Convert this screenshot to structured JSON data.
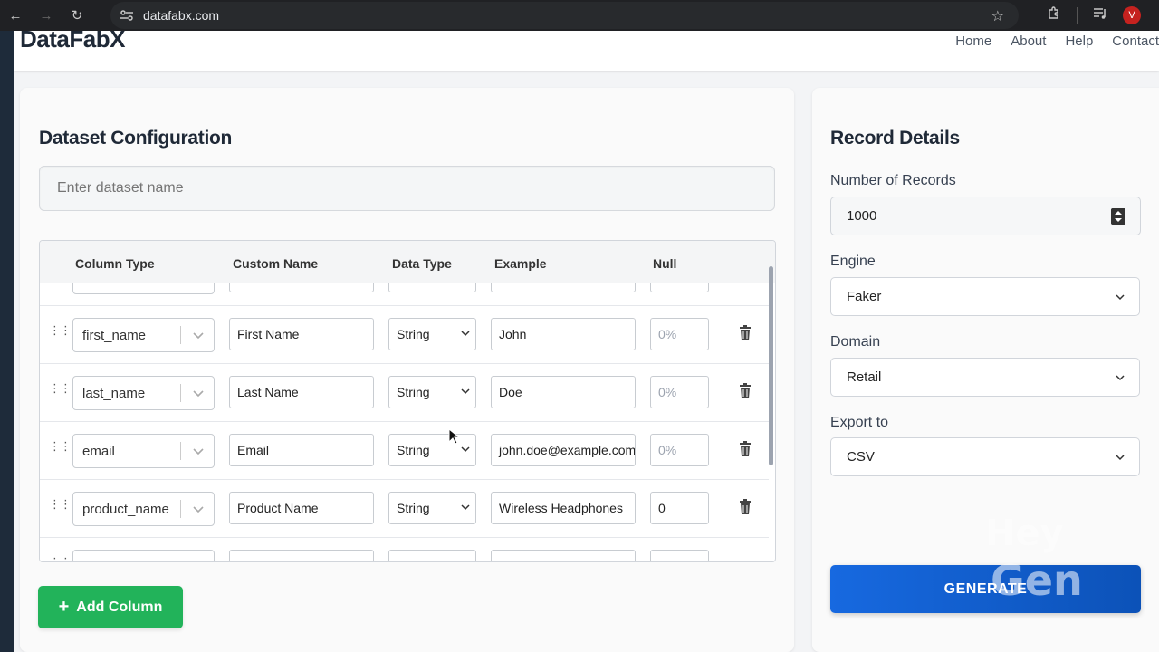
{
  "browser": {
    "url": "datafabx.com",
    "profile_initial": "V"
  },
  "site": {
    "brand": "DataFabX",
    "nav": [
      "Home",
      "About",
      "Help",
      "Contact"
    ]
  },
  "dataset": {
    "title": "Dataset Configuration",
    "name_placeholder": "Enter dataset name",
    "columns_header": [
      "Column Type",
      "Custom Name",
      "Data Type",
      "Example",
      "Null"
    ],
    "rows": [
      {
        "column_type": "first_name",
        "custom_name": "First Name",
        "data_type": "String",
        "example": "John",
        "null": "0%"
      },
      {
        "column_type": "last_name",
        "custom_name": "Last Name",
        "data_type": "String",
        "example": "Doe",
        "null": "0%"
      },
      {
        "column_type": "email",
        "custom_name": "Email",
        "data_type": "String",
        "example": "john.doe@example.com",
        "null": "0%"
      },
      {
        "column_type": "product_name",
        "custom_name": "Product Name",
        "data_type": "String",
        "example": "Wireless Headphones",
        "null": "0"
      }
    ],
    "add_column_label": "Add Column"
  },
  "record_details": {
    "title": "Record Details",
    "records_label": "Number of Records",
    "records_value": "1000",
    "engine_label": "Engine",
    "engine_value": "Faker",
    "domain_label": "Domain",
    "domain_value": "Retail",
    "export_label": "Export to",
    "export_value": "CSV",
    "generate_label": "GENERATE"
  },
  "watermark": {
    "line1": "Hey",
    "line2": "Gen"
  },
  "colors": {
    "add_button": "#22b35a",
    "generate_button": "#1769e0",
    "avatar": "#c5221f"
  }
}
